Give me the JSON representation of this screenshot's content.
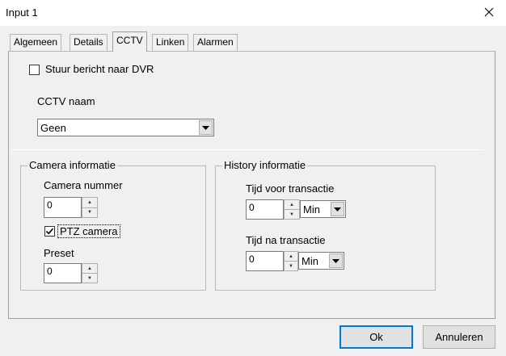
{
  "window": {
    "title": "Input 1",
    "close_icon": "close-icon"
  },
  "tabs": [
    {
      "label": "Algemeen"
    },
    {
      "label": "Details"
    },
    {
      "label": "CCTV",
      "active": true
    },
    {
      "label": "Linken"
    },
    {
      "label": "Alarmen"
    }
  ],
  "cctv": {
    "send_to_dvr": {
      "label": "Stuur bericht naar DVR",
      "checked": false
    },
    "name_label": "CCTV naam",
    "name_value": "Geen"
  },
  "camera_info": {
    "legend": "Camera informatie",
    "number_label": "Camera nummer",
    "number_value": "0",
    "ptz": {
      "label": "PTZ camera",
      "checked": true
    },
    "preset_label": "Preset",
    "preset_value": "0"
  },
  "history_info": {
    "legend": "History informatie",
    "before_label": "Tijd voor transactie",
    "before_value": "0",
    "before_unit": "Min",
    "after_label": "Tijd na transactie",
    "after_value": "0",
    "after_unit": "Min"
  },
  "buttons": {
    "ok": "Ok",
    "cancel": "Annuleren"
  }
}
